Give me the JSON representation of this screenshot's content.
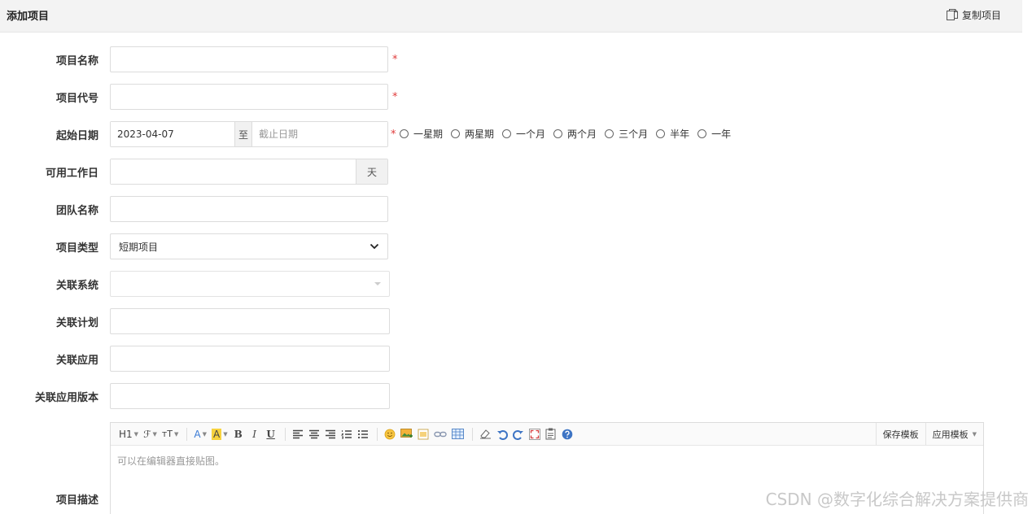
{
  "header": {
    "title": "添加项目",
    "copy_label": "复制项目"
  },
  "form": {
    "name": {
      "label": "项目名称",
      "value": "",
      "required": "*"
    },
    "code": {
      "label": "项目代号",
      "value": "",
      "required": "*"
    },
    "dates": {
      "label": "起始日期",
      "start": "2023-04-07",
      "separator": "至",
      "end_placeholder": "截止日期",
      "required": "*",
      "quick_options": [
        "一星期",
        "两星期",
        "一个月",
        "两个月",
        "三个月",
        "半年",
        "一年"
      ]
    },
    "workdays": {
      "label": "可用工作日",
      "value": "",
      "unit": "天"
    },
    "team": {
      "label": "团队名称",
      "value": ""
    },
    "type": {
      "label": "项目类型",
      "selected": "短期项目"
    },
    "system": {
      "label": "关联系统",
      "value": ""
    },
    "plan": {
      "label": "关联计划",
      "value": ""
    },
    "app": {
      "label": "关联应用",
      "value": ""
    },
    "app_version": {
      "label": "关联应用版本",
      "value": ""
    },
    "description": {
      "label": "项目描述",
      "placeholder": "可以在编辑器直接贴图。",
      "toolbar": {
        "heading": "H1",
        "font": "ℱ",
        "size": "тT",
        "font_color": "A",
        "bg_color": "A",
        "bold": "B",
        "italic": "I",
        "underline": "U",
        "save_template": "保存模板",
        "apply_template": "应用模板"
      }
    }
  },
  "watermark": "CSDN @数字化综合解决方案提供商",
  "colors": {
    "required": "#e03a3a",
    "header_bg": "#f3f3f3",
    "border": "#dcdcdc"
  }
}
